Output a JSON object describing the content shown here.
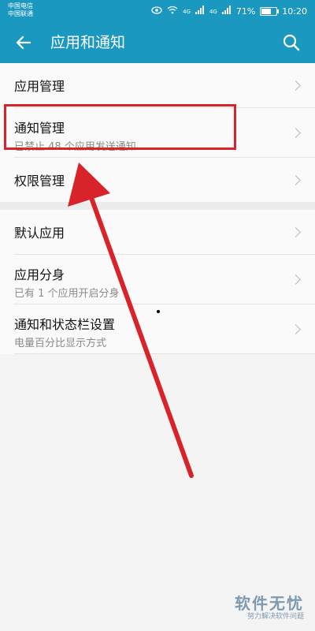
{
  "status_bar": {
    "carrier1": "中国电信",
    "carrier2": "中国联通",
    "eye_icon": "eye-icon",
    "wifi_icon": "wifi-icon",
    "net1": "4G",
    "net2": "4G",
    "battery_percent": "71%",
    "battery_level": 0.71,
    "time": "10:20"
  },
  "header": {
    "title": "应用和通知",
    "back_icon": "arrow-left-icon",
    "search_icon": "search-icon"
  },
  "settings": {
    "group1": [
      {
        "label": "应用管理",
        "sub": ""
      },
      {
        "label": "通知管理",
        "sub": "已禁止 48 个应用发送通知"
      },
      {
        "label": "权限管理",
        "sub": ""
      }
    ],
    "group2": [
      {
        "label": "默认应用",
        "sub": ""
      },
      {
        "label": "应用分身",
        "sub": "已有 1 个应用开启分身"
      },
      {
        "label": "通知和状态栏设置",
        "sub": "电量百分比显示方式"
      }
    ]
  },
  "annotation": {
    "color": "#d8232a"
  },
  "watermark": {
    "main": "软件无忧",
    "sub": "努力解决软件问题"
  },
  "colors": {
    "accent": "#1b98c0"
  }
}
